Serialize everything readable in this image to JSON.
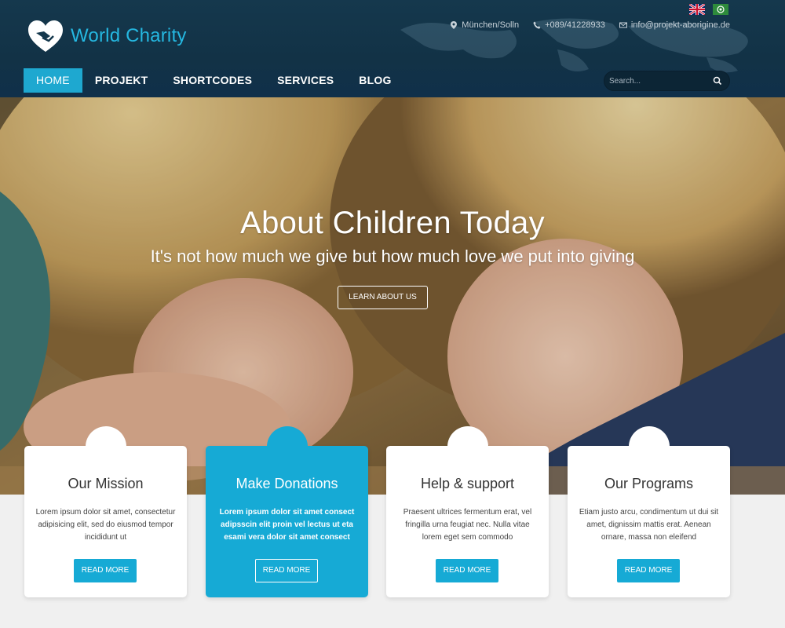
{
  "brand": {
    "name": "World Charity"
  },
  "languages": [
    {
      "code": "en",
      "icon": "uk-flag-icon"
    },
    {
      "code": "ar",
      "icon": "arabic-flag-icon"
    }
  ],
  "contact": {
    "location": "München/Solln",
    "phone": "+089/41228933",
    "email": "info@projekt-aborigine.de"
  },
  "nav": {
    "items": [
      "HOME",
      "PROJEKT",
      "SHORTCODES",
      "SERVICES",
      "BLOG"
    ],
    "active": "HOME"
  },
  "search": {
    "placeholder": "Search..."
  },
  "hero": {
    "title": "About Children Today",
    "subtitle": "It's not how much we give but how much love we put into giving",
    "button_label": "LEARN ABOUT US"
  },
  "cards": [
    {
      "title": "Our Mission",
      "text": "Lorem ipsum dolor sit amet, consectetur adipisicing elit, sed do eiusmod tempor incididunt ut",
      "button_label": "READ MORE",
      "featured": false
    },
    {
      "title": "Make Donations",
      "text": "Lorem ipsum dolor sit amet consect adipsscin elit proin vel lectus ut eta esami vera dolor sit amet consect",
      "button_label": "READ MORE",
      "featured": true
    },
    {
      "title": "Help & support",
      "text": "Praesent ultrices fermentum erat, vel fringilla urna feugiat nec. Nulla vitae lorem eget sem commodo",
      "button_label": "READ MORE",
      "featured": false
    },
    {
      "title": "Our Programs",
      "text": "Etiam justo arcu, condimentum ut dui sit amet, dignissim mattis erat. Aenean ornare, massa non eleifend",
      "button_label": "READ MORE",
      "featured": false
    }
  ],
  "colors": {
    "accent": "#16aad5",
    "header_bg": "#15384d",
    "page_bg": "#f0f0f0"
  }
}
